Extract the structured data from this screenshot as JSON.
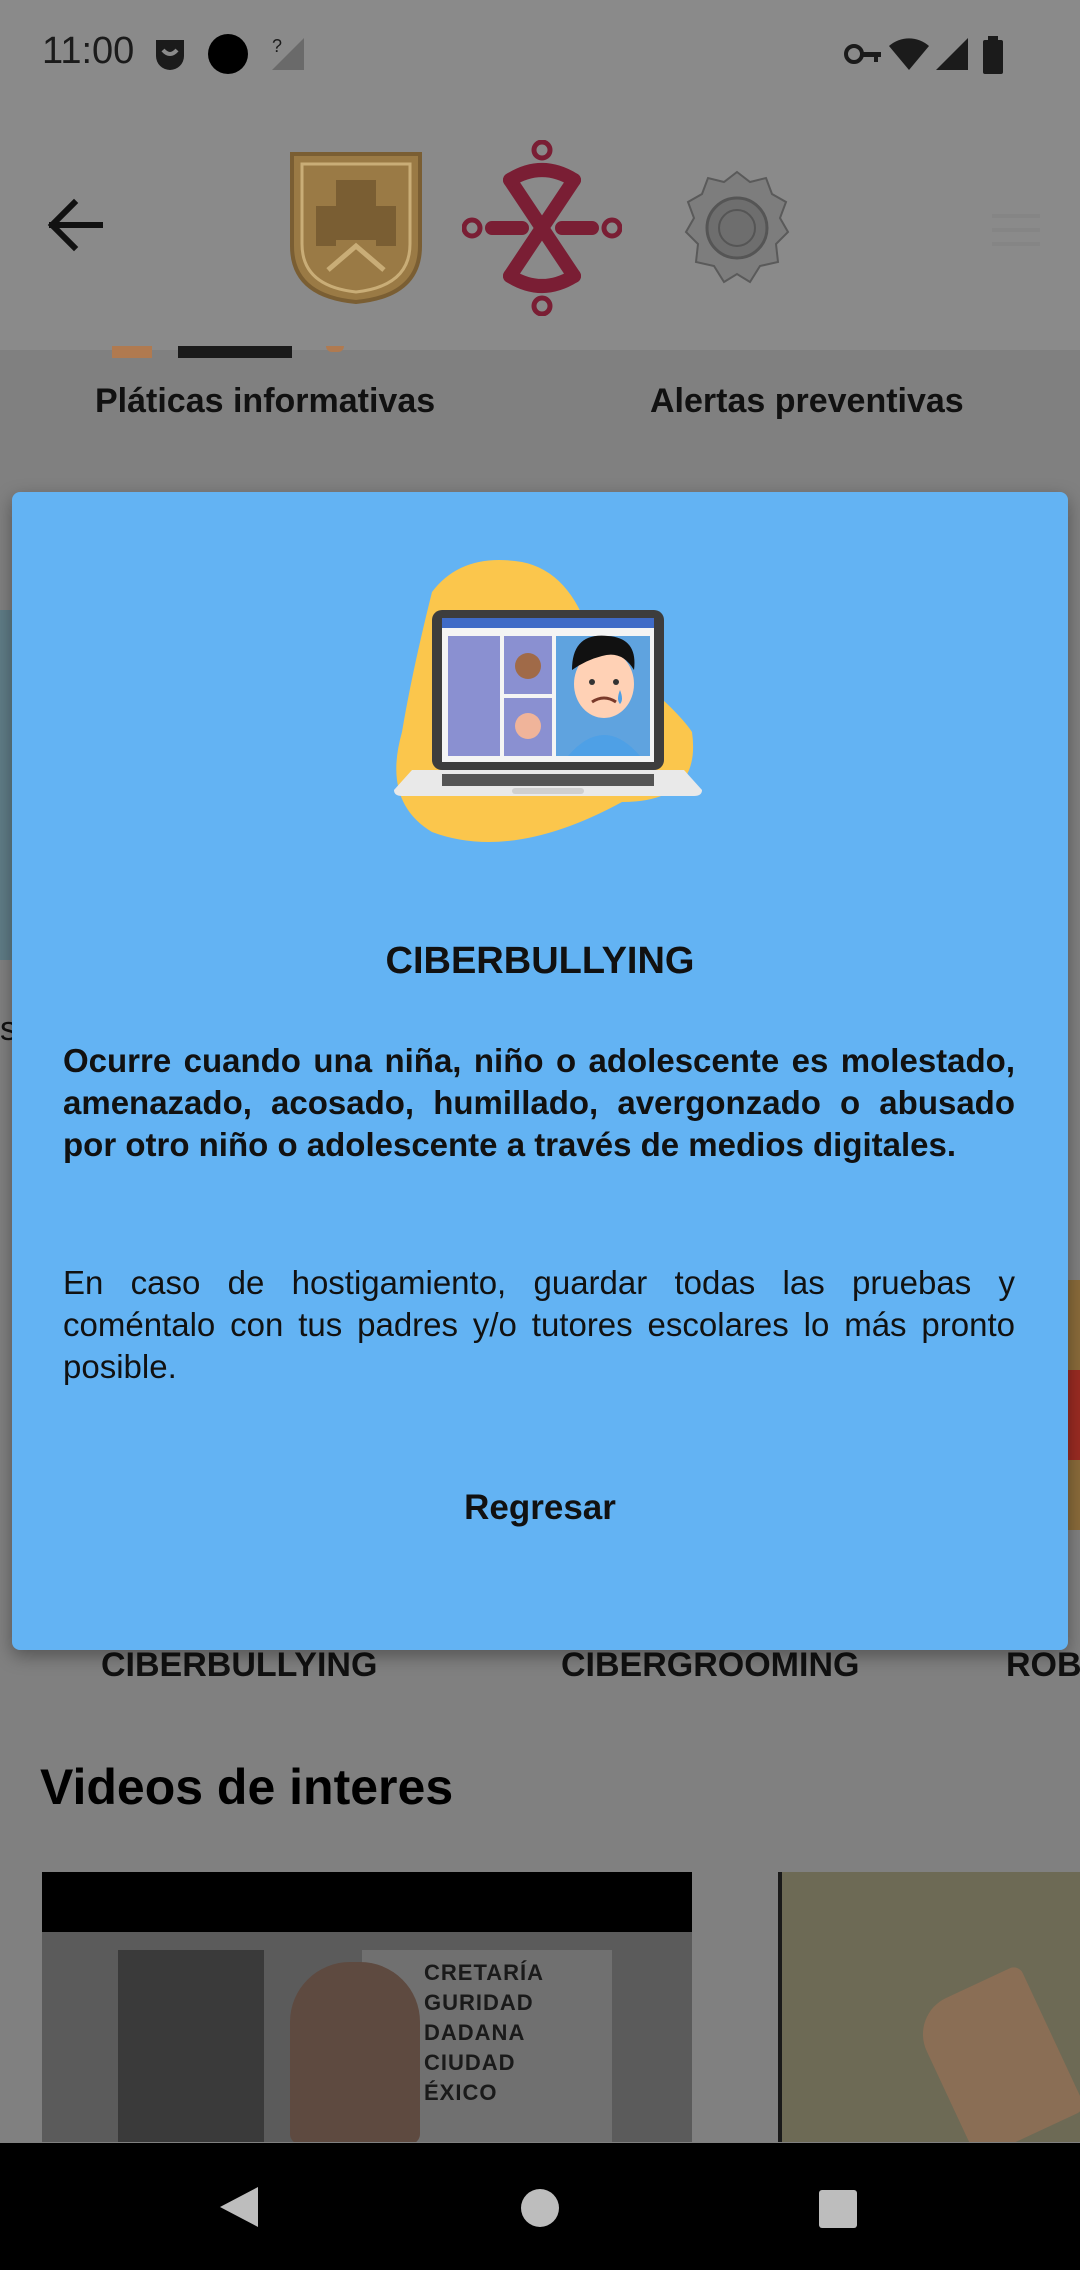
{
  "status_bar": {
    "time": "11:00",
    "icons_left": [
      "privacy-icon",
      "dot-icon",
      "no-signal-icon"
    ],
    "icons_right": [
      "vpn-key-icon",
      "wifi-icon",
      "cell-signal-icon",
      "battery-icon"
    ]
  },
  "app_bar": {
    "back_icon": "arrow-left-icon",
    "logos": [
      "cdmx-crest-logo",
      "government-knot-logo",
      "police-seal-logo"
    ],
    "menu_icon": "hamburger-menu-icon"
  },
  "categories": {
    "top": [
      "Pláticas informativas",
      "Alertas preventivas"
    ],
    "bottom": [
      "CIBERBULLYING",
      "CIBERGROOMING",
      "ROB"
    ]
  },
  "videos_section": {
    "title": "Videos de interes",
    "thumb1_text": [
      "CRETARÍA",
      "GURIDAD",
      "DADANA",
      "CIUDAD",
      "ÉXICO"
    ]
  },
  "dialog": {
    "title": "CIBERBULLYING",
    "description": "Ocurre cuando una niña, niño o adolescente es molestado, amenazado, acosado, humillado, avergonzado o abusado por otro niño o adolescente a través de medios digitales.",
    "advice": "En caso de hostigamiento, guardar todas las pruebas y coméntalo con tus padres y/o tutores escolares lo más pronto posible.",
    "button_label": "Regresar",
    "illustration": "sad-child-laptop-illustration"
  },
  "colors": {
    "dialog_bg": "#63b3f3",
    "crest_gold": "#9a7a45",
    "brand_wine": "#7a1e34",
    "scrim": "#808080"
  }
}
